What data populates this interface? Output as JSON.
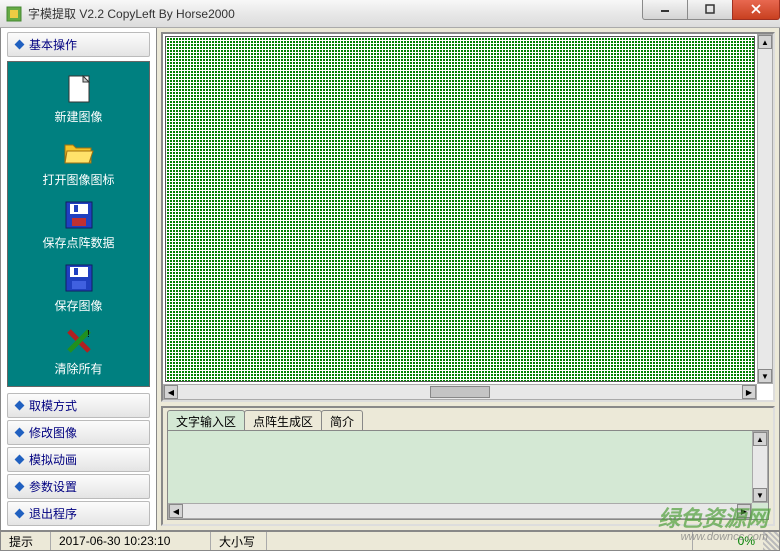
{
  "window": {
    "title": "字模提取 V2.2  CopyLeft By Horse2000"
  },
  "sidebar": {
    "active_group": "基本操作",
    "tools": [
      {
        "label": "新建图像",
        "icon": "new-file"
      },
      {
        "label": "打开图像图标",
        "icon": "open-folder"
      },
      {
        "label": "保存点阵数据",
        "icon": "save-disk-red"
      },
      {
        "label": "保存图像",
        "icon": "save-disk-blue"
      },
      {
        "label": "清除所有",
        "icon": "clear-x"
      }
    ],
    "collapsed_groups": [
      "取模方式",
      "修改图像",
      "模拟动画",
      "参数设置",
      "退出程序"
    ]
  },
  "bottom_tabs": {
    "items": [
      "文字输入区",
      "点阵生成区",
      "简介"
    ],
    "active_index": 0
  },
  "statusbar": {
    "hint": "提示",
    "datetime": "2017-06-30 10:23:10",
    "caps": "大小写",
    "percent": "0%"
  },
  "watermark": {
    "main": "绿色资源网",
    "sub": "www.downcc.com"
  }
}
